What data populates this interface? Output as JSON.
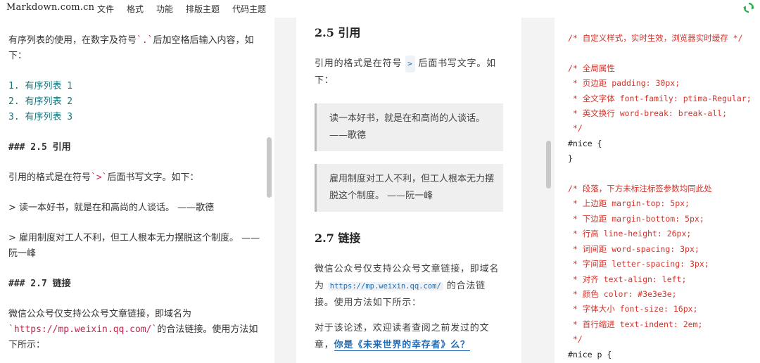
{
  "nav": {
    "brand": "Markdown.com.cn",
    "menu": [
      "文件",
      "格式",
      "功能",
      "排版主题",
      "代码主题"
    ]
  },
  "editor": {
    "intro": "有序列表的使用，在数字及符号",
    "intro_code": "`.`",
    "intro_tail": "后加空格后输入内容，如下：",
    "ol_items": [
      "1. 有序列表 1",
      "2. 有序列表 2",
      "3. 有序列表 3"
    ],
    "h_quote": "### 2.5 引用",
    "quote_desc_a": "引用的格式是在符号",
    "quote_desc_code": "`>`",
    "quote_desc_b": "后面书写文字。如下：",
    "quote1": "> 读一本好书，就是在和高尚的人谈话。 ——歌德",
    "quote2": "> 雇用制度对工人不利，但工人根本无力摆脱这个制度。 ——阮一峰",
    "h_link": "### 2.7 链接",
    "link_desc_a": "微信公众号仅支持公众号文章链接，即域名为",
    "link_desc_code": "`https://mp.weixin.qq.com/`",
    "link_desc_b": "的合法链接。使用方法如下所示："
  },
  "preview": {
    "h_quote": "2.5 引用",
    "quote_desc_a": "引用的格式是在符号",
    "quote_desc_code": ">",
    "quote_desc_b": "后面书写文字。如下：",
    "quote1": "读一本好书，就是在和高尚的人谈话。 ——歌德",
    "quote2": "雇用制度对工人不利，但工人根本无力摆脱这个制度。 ——阮一峰",
    "h_link": "2.7 链接",
    "link_desc_a": "微信公众号仅支持公众号文章链接，即域名为",
    "link_url": "https://mp.weixin.qq.com/",
    "link_desc_b": "的合法链接。使用方法如下所示：",
    "more_a": "对于该论述，欢迎读者查阅之前发过的文章，",
    "more_link": "你是《未来世界的幸存者》么？"
  },
  "css_lines": [
    {
      "text": "/* 自定义样式，实时生效，浏览器实时缓存 */",
      "type": "comment"
    },
    {
      "text": "",
      "type": "plain"
    },
    {
      "text": "/* 全局属性",
      "type": "comment"
    },
    {
      "text": " * 页边距 padding: 30px;",
      "type": "comment"
    },
    {
      "text": " * 全文字体 font-family: ptima-Regular;",
      "type": "comment"
    },
    {
      "text": " * 英文换行 word-break: break-all;",
      "type": "comment"
    },
    {
      "text": " */",
      "type": "comment"
    },
    {
      "text": "#nice {",
      "type": "plain"
    },
    {
      "text": "}",
      "type": "plain"
    },
    {
      "text": "",
      "type": "plain"
    },
    {
      "text": "/* 段落，下方未标注标签参数均同此处",
      "type": "comment"
    },
    {
      "text": " * 上边距 margin-top: 5px;",
      "type": "comment"
    },
    {
      "text": " * 下边距 margin-bottom: 5px;",
      "type": "comment"
    },
    {
      "text": " * 行高 line-height: 26px;",
      "type": "comment"
    },
    {
      "text": " * 词间距 word-spacing: 3px;",
      "type": "comment"
    },
    {
      "text": " * 字间距 letter-spacing: 3px;",
      "type": "comment"
    },
    {
      "text": " * 对齐 text-align: left;",
      "type": "comment"
    },
    {
      "text": " * 颜色 color: #3e3e3e;",
      "type": "comment"
    },
    {
      "text": " * 字体大小 font-size: 16px;",
      "type": "comment"
    },
    {
      "text": " * 首行缩进 text-indent: 2em;",
      "type": "comment"
    },
    {
      "text": " */",
      "type": "comment"
    },
    {
      "text": "#nice p {",
      "type": "plain"
    }
  ],
  "colors": {
    "comment": "#d6332a",
    "ordered_list": "#167479",
    "link": "#1e6bb8",
    "sync_icon": "#2bae4e"
  },
  "icons": {
    "sync": "sync-icon"
  }
}
